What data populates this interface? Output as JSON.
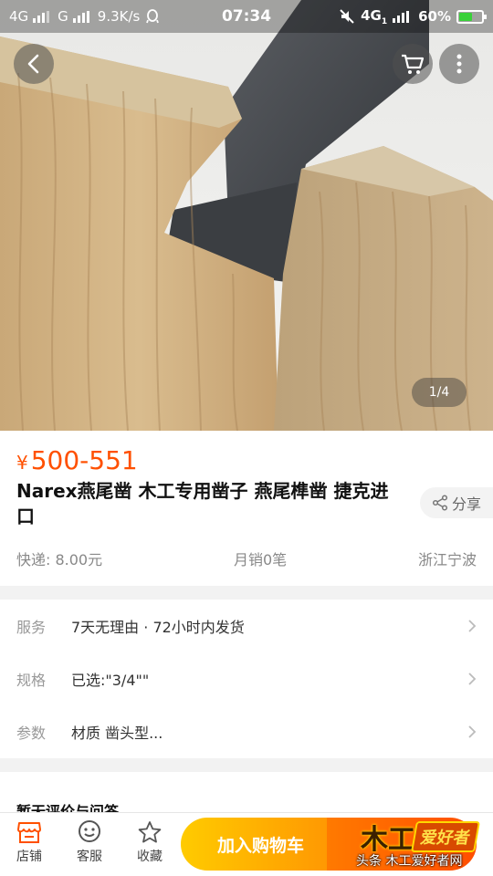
{
  "status_bar": {
    "signal1": "4G",
    "signal2": "G",
    "speed": "9.3K/s",
    "time": "07:34",
    "network": "4G",
    "network_sub": "1",
    "battery": "60%",
    "battery_level": 0.6
  },
  "gallery": {
    "pager": "1/4"
  },
  "product": {
    "currency": "¥",
    "price": "500-551",
    "title": "Narex燕尾凿 木工专用凿子 燕尾榫凿 捷克进口",
    "share_label": "分享",
    "shipping": "快递: 8.00元",
    "monthly_sales": "月销0笔",
    "location": "浙江宁波"
  },
  "rows": [
    {
      "label": "服务",
      "text": "7天无理由 · 72小时内发货"
    },
    {
      "label": "规格",
      "text": "已选:\"3/4\"\""
    },
    {
      "label": "参数",
      "text": "材质 凿头型..."
    }
  ],
  "reviews": {
    "title": "暂无评价与问答"
  },
  "bottom_bar": {
    "store_label": "店铺",
    "service_label": "客服",
    "favorite_label": "收藏",
    "add_to_cart_label": "加入购物车"
  },
  "watermark": {
    "logo_char": "木工",
    "logo_pill": "爱好者",
    "caption": "头条  木工爱好者网"
  },
  "colors": {
    "accent": "#ff5000",
    "cart_gradient_start": "#ffcb00",
    "cart_gradient_end": "#ff9402"
  }
}
